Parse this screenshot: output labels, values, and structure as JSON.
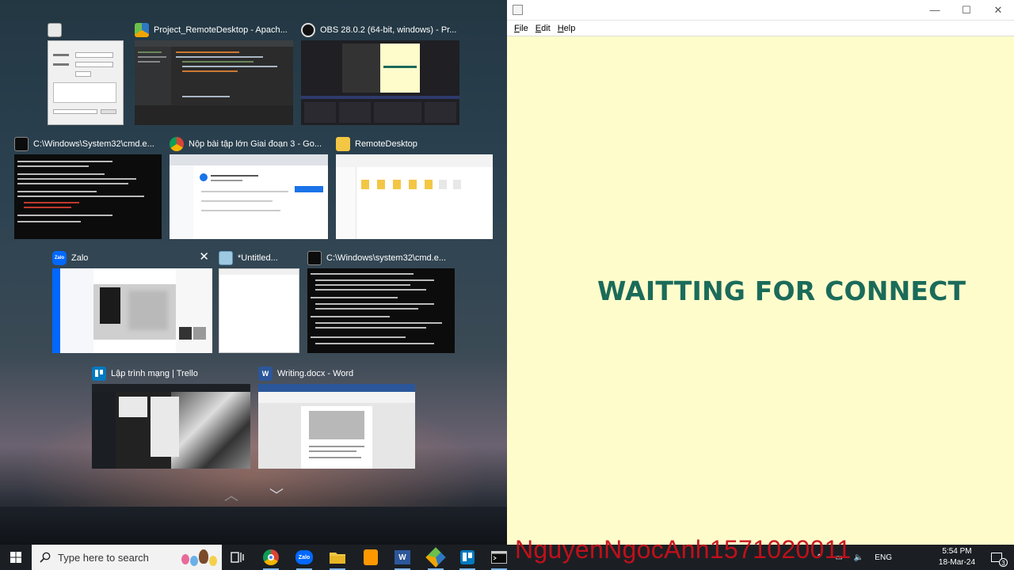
{
  "task_view": {
    "windows": [
      {
        "title": ""
      },
      {
        "title": "Project_RemoteDesktop - Apach..."
      },
      {
        "title": "OBS 28.0.2 (64-bit, windows) - Pr..."
      },
      {
        "title": "C:\\Windows\\System32\\cmd.e..."
      },
      {
        "title": "Nộp bài tập lớn Giai đoạn 3 - Go..."
      },
      {
        "title": "RemoteDesktop"
      },
      {
        "title": "Zalo"
      },
      {
        "title": "*Untitled..."
      },
      {
        "title": "C:\\Windows\\system32\\cmd.e..."
      },
      {
        "title": "Lập trình mạng | Trello"
      },
      {
        "title": "Writing.docx - Word"
      }
    ],
    "close_symbol": "✕",
    "scroll_up_symbol": "︿",
    "scroll_down_symbol": "﹀"
  },
  "app_window": {
    "menu": [
      "File",
      "Edit",
      "Help"
    ],
    "minimize_symbol": "—",
    "maximize_symbol": "☐",
    "close_symbol": "✕",
    "status_text": "WAITTING FOR CONNECT",
    "status_color": "#1b6b5a",
    "background_color": "#fffccc"
  },
  "taskbar": {
    "search_placeholder": "Type here to search",
    "overlay_text": "NguyenNgocAnh1571020011",
    "overlay_color": "#c8101a",
    "language": "ENG",
    "time": "5:54 PM",
    "date": "18-Mar-24",
    "notification_count": "3",
    "pinned": [
      "task-view-icon",
      "chrome-icon",
      "zalo-icon",
      "file-explorer-icon",
      "sublime-icon",
      "word-icon",
      "netbeans-icon",
      "trello-icon",
      "cmd-icon"
    ]
  },
  "thumb_icon_labels": {
    "zalo": "Zalo",
    "word": "W"
  }
}
